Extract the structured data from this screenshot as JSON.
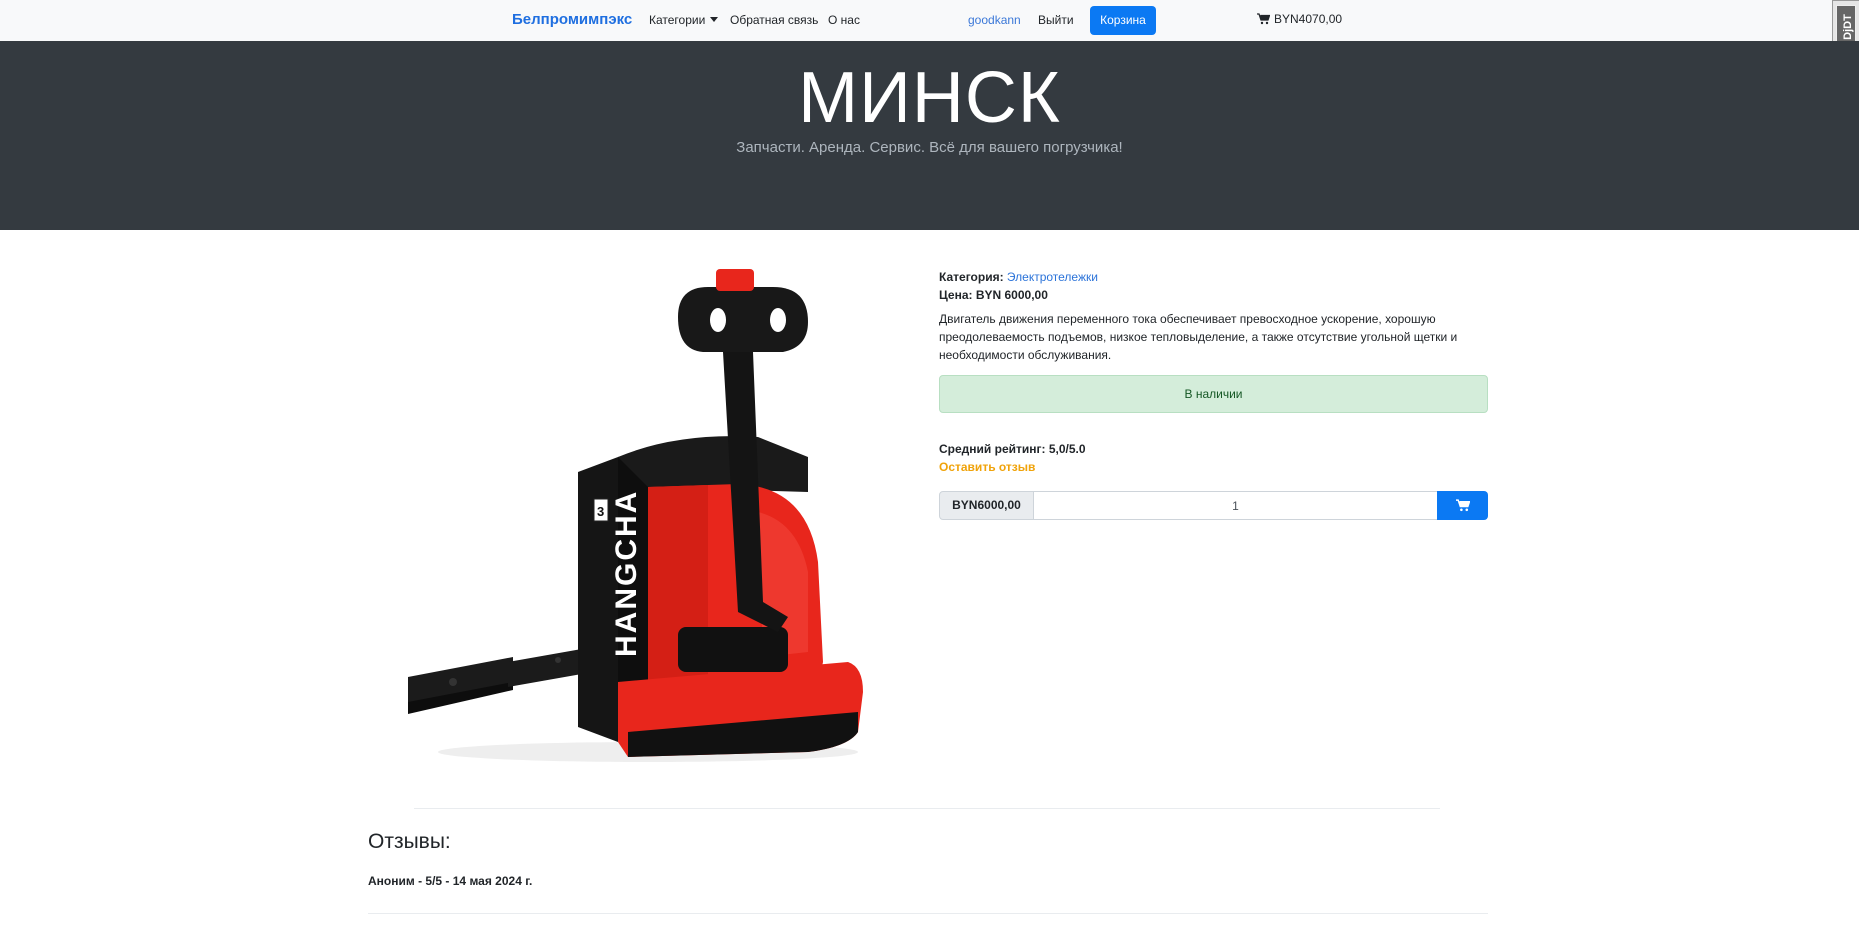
{
  "navbar": {
    "brand": "Белпромимпэкс",
    "categories": "Категории",
    "feedback": "Обратная связь",
    "about": "О нас",
    "username": "goodkann",
    "logout": "Выйти",
    "cart": "Корзина",
    "cart_total": "BYN4070,00"
  },
  "ddt": "DjDT",
  "hero": {
    "title": "МИНСК",
    "subtitle": "Запчасти. Аренда. Сервис. Всё для вашего погрузчика!"
  },
  "product": {
    "category_label": "Категория:",
    "category_value": "Электротележки",
    "price_label": "Цена: BYN 6000,00",
    "description": "Двигатель движения переменного тока обеспечивает превосходное ускорение, хорошую преодолеваемость подъемов, низкое тепловыделение, а также отсутствие угольной щетки и необходимости обслуживания.",
    "stock_status": "В наличии",
    "rating": "Средний рейтинг: 5,0/5.0",
    "leave_review": "Оставить отзыв",
    "price_tag": "BYN6000,00",
    "quantity": "1",
    "image_brand": "HANGCHA"
  },
  "reviews": {
    "title": "Отзывы:",
    "items": [
      {
        "text": "Аноним - 5/5 - 14 мая 2024 г."
      }
    ]
  },
  "colors": {
    "primary": "#0b79f3",
    "hero_bg": "#343a40",
    "success_bg": "#d4edda",
    "warning": "#f0a30a",
    "truck_red": "#e8261c"
  },
  "icons": {
    "cart": "shopping-cart-icon",
    "caret": "caret-down-icon"
  }
}
